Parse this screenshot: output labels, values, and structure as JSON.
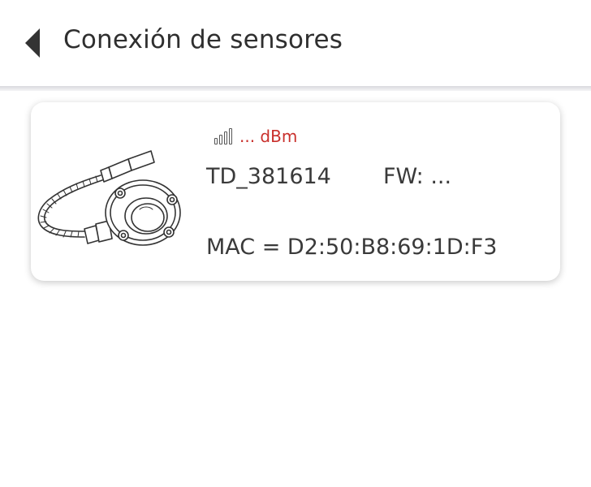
{
  "header": {
    "title": "Conexión de sensores",
    "back_icon": "chevron-left-icon"
  },
  "device": {
    "image_icon": "pressure-sensor-icon",
    "signal_icon": "signal-strength-icon",
    "signal_text": "... dBm",
    "name": "TD_381614",
    "firmware": "FW: ...",
    "mac": "MAC = D2:50:B8:69:1D:F3"
  },
  "colors": {
    "signal_text": "#c9302c",
    "text": "#3a3a3a",
    "title": "#2f2f2f",
    "background": "#ffffff"
  }
}
